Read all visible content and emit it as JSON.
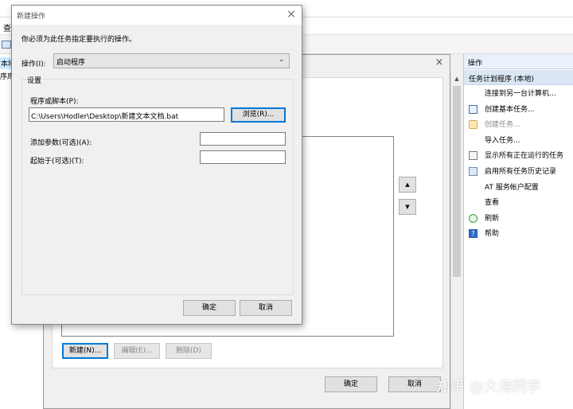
{
  "background": {
    "menu_fragment": "查",
    "tree_fragment_1": "本地)",
    "tree_fragment_2": "序库"
  },
  "actions_panel": {
    "title": "操作",
    "section": "任务计划程序 (本地)",
    "items": [
      {
        "label": "连接到另一台计算机...",
        "icon": "none",
        "enabled": true
      },
      {
        "label": "创建基本任务...",
        "icon": "task-wizard-icon",
        "enabled": true
      },
      {
        "label": "创建任务...",
        "icon": "task-create-icon",
        "enabled": false
      },
      {
        "label": "导入任务...",
        "icon": "none",
        "enabled": true
      },
      {
        "label": "显示所有正在运行的任务",
        "icon": "running-tasks-icon",
        "enabled": true
      },
      {
        "label": "启用所有任务历史记录",
        "icon": "history-icon",
        "enabled": true
      },
      {
        "label": "AT 服务帐户配置",
        "icon": "none",
        "enabled": true
      },
      {
        "label": "查看",
        "icon": "none",
        "enabled": true
      },
      {
        "label": "刷新",
        "icon": "refresh-icon",
        "enabled": true
      },
      {
        "label": "帮助",
        "icon": "help-icon",
        "enabled": true
      }
    ]
  },
  "parent_dialog": {
    "new_button": "新建(N)...",
    "edit_button": "编辑(E)...",
    "delete_button": "删除(D)",
    "ok_button": "确定",
    "cancel_button": "取消"
  },
  "dialog": {
    "title": "新建操作",
    "instruction": "你必须为此任务指定要执行的操作。",
    "action_label": "操作(I):",
    "action_value": "启动程序",
    "settings_group": "设置",
    "program_label": "程序或脚本(P):",
    "program_value": "C:\\Users\\Hodler\\Desktop\\新建文本文档.bat",
    "browse_button": "浏览(R)...",
    "args_label": "添加参数(可选)(A):",
    "args_value": "",
    "start_in_label": "起始于(可选)(T):",
    "start_in_value": "",
    "ok_button": "确定",
    "cancel_button": "取消"
  },
  "watermark": "知乎 @大海同学",
  "colors": {
    "accent": "#0078d7",
    "panel_header": "#eaf1fb",
    "section_bar": "#dbe6f4"
  }
}
